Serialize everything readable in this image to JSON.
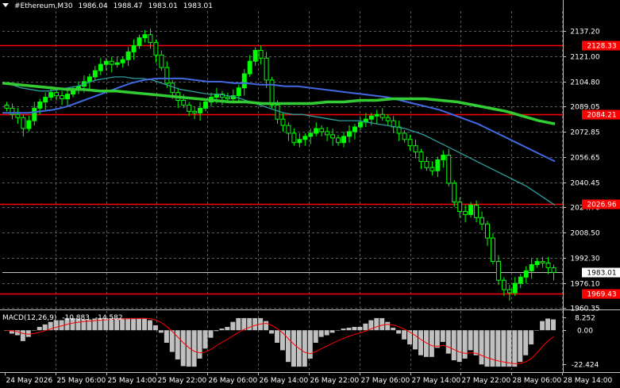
{
  "window": {
    "symbol": "#Ethereum,M30",
    "ohlc": [
      "1986.04",
      "1988.47",
      "1983.01",
      "1983.01"
    ]
  },
  "colors": {
    "background": "#000000",
    "grid": "#5a5a5a",
    "bull_candle": "#00ff00",
    "ma_fast": "#2e9c9c",
    "ma_mid": "#4169e1",
    "ma_slow": "#32cd32",
    "level_line": "#ff0000",
    "macd_hist": "#c0c0c0",
    "macd_signal": "#ff0000",
    "price_line": "#c0c0c0"
  },
  "chart_data": [
    {
      "type": "candlestick",
      "ylim": [
        1960.35,
        2145.0
      ],
      "y_ticks": [
        "2137.20",
        "2121.00",
        "2104.80",
        "2089.05",
        "2072.85",
        "2056.65",
        "2040.45",
        "2024.70",
        "2008.50",
        "1992.30",
        "1976.10",
        "1960.35"
      ],
      "x_ticks": [
        "24 May 2026",
        "25 May 06:00",
        "25 May 14:00",
        "25 May 22:00",
        "26 May 06:00",
        "26 May 14:00",
        "26 May 22:00",
        "27 May 06:00",
        "27 May 14:00",
        "27 May 22:00",
        "28 May 06:00",
        "28 May 14:00"
      ],
      "levels": [
        {
          "label": "2128.33",
          "value": 2128.33
        },
        {
          "label": "2084.21",
          "value": 2084.21
        },
        {
          "label": "2026.96",
          "value": 2026.96
        },
        {
          "label": "1969.43",
          "value": 1969.43
        }
      ],
      "current_price": {
        "label": "1983.01",
        "value": 1983.01
      },
      "close_series": [
        2088,
        2084,
        2082,
        2075,
        2080,
        2088,
        2092,
        2095,
        2098,
        2096,
        2094,
        2097,
        2100,
        2102,
        2105,
        2108,
        2112,
        2116,
        2118,
        2116,
        2117,
        2119,
        2124,
        2128,
        2133,
        2135,
        2130,
        2122,
        2114,
        2104,
        2098,
        2093,
        2090,
        2086,
        2085,
        2088,
        2092,
        2095,
        2097,
        2095,
        2094,
        2096,
        2101,
        2110,
        2118,
        2125,
        2120,
        2106,
        2090,
        2081,
        2077,
        2072,
        2066,
        2068,
        2070,
        2072,
        2075,
        2073,
        2071,
        2069,
        2066,
        2070,
        2073,
        2076,
        2079,
        2081,
        2083,
        2084,
        2082,
        2080,
        2076,
        2072,
        2068,
        2064,
        2060,
        2054,
        2050,
        2048,
        2055,
        2058,
        2040,
        2028,
        2022,
        2020,
        2026,
        2018,
        2014,
        2005,
        1990,
        1978,
        1972,
        1970,
        1976,
        1980,
        1984,
        1988,
        1990,
        1989,
        1986,
        1983
      ],
      "ma_fast": [
        2104,
        2103,
        2101,
        2100,
        2099,
        2099,
        2100,
        2101,
        2102,
        2104,
        2106,
        2107,
        2108,
        2108,
        2107,
        2107,
        2106,
        2104,
        2102,
        2100,
        2099,
        2098,
        2097,
        2097,
        2096,
        2095,
        2093,
        2091,
        2089,
        2087,
        2085,
        2084,
        2084,
        2083,
        2082,
        2081,
        2080,
        2080,
        2080,
        2079,
        2078,
        2077,
        2076,
        2075,
        2073,
        2071,
        2068,
        2065,
        2062,
        2059,
        2056,
        2053,
        2050,
        2047,
        2044,
        2041,
        2038,
        2034,
        2030,
        2026
      ],
      "ma_mid": [
        2085,
        2085,
        2085,
        2086,
        2087,
        2089,
        2092,
        2095,
        2098,
        2101,
        2104,
        2106,
        2107,
        2107,
        2107,
        2106,
        2105,
        2105,
        2104,
        2104,
        2103,
        2103,
        2102,
        2102,
        2101,
        2100,
        2099,
        2098,
        2097,
        2096,
        2095,
        2093,
        2091,
        2089,
        2087,
        2084,
        2081,
        2078,
        2074,
        2070,
        2066,
        2062,
        2058,
        2054
      ],
      "ma_slow": [
        2104,
        2103,
        2102,
        2101,
        2100,
        2100,
        2099,
        2099,
        2098,
        2097,
        2096,
        2095,
        2094,
        2093,
        2092,
        2092,
        2091,
        2091,
        2091,
        2091,
        2092,
        2092,
        2093,
        2093,
        2094,
        2094,
        2094,
        2093,
        2092,
        2090,
        2088,
        2086,
        2083,
        2080,
        2078
      ],
      "macd": {
        "label": "MACD(12,26,9)",
        "values": [
          "-10.883",
          "-14.582"
        ],
        "y_ticks": [
          "8.252",
          "0.00",
          "-22.424"
        ],
        "ylim": [
          -25,
          9
        ]
      }
    }
  ]
}
